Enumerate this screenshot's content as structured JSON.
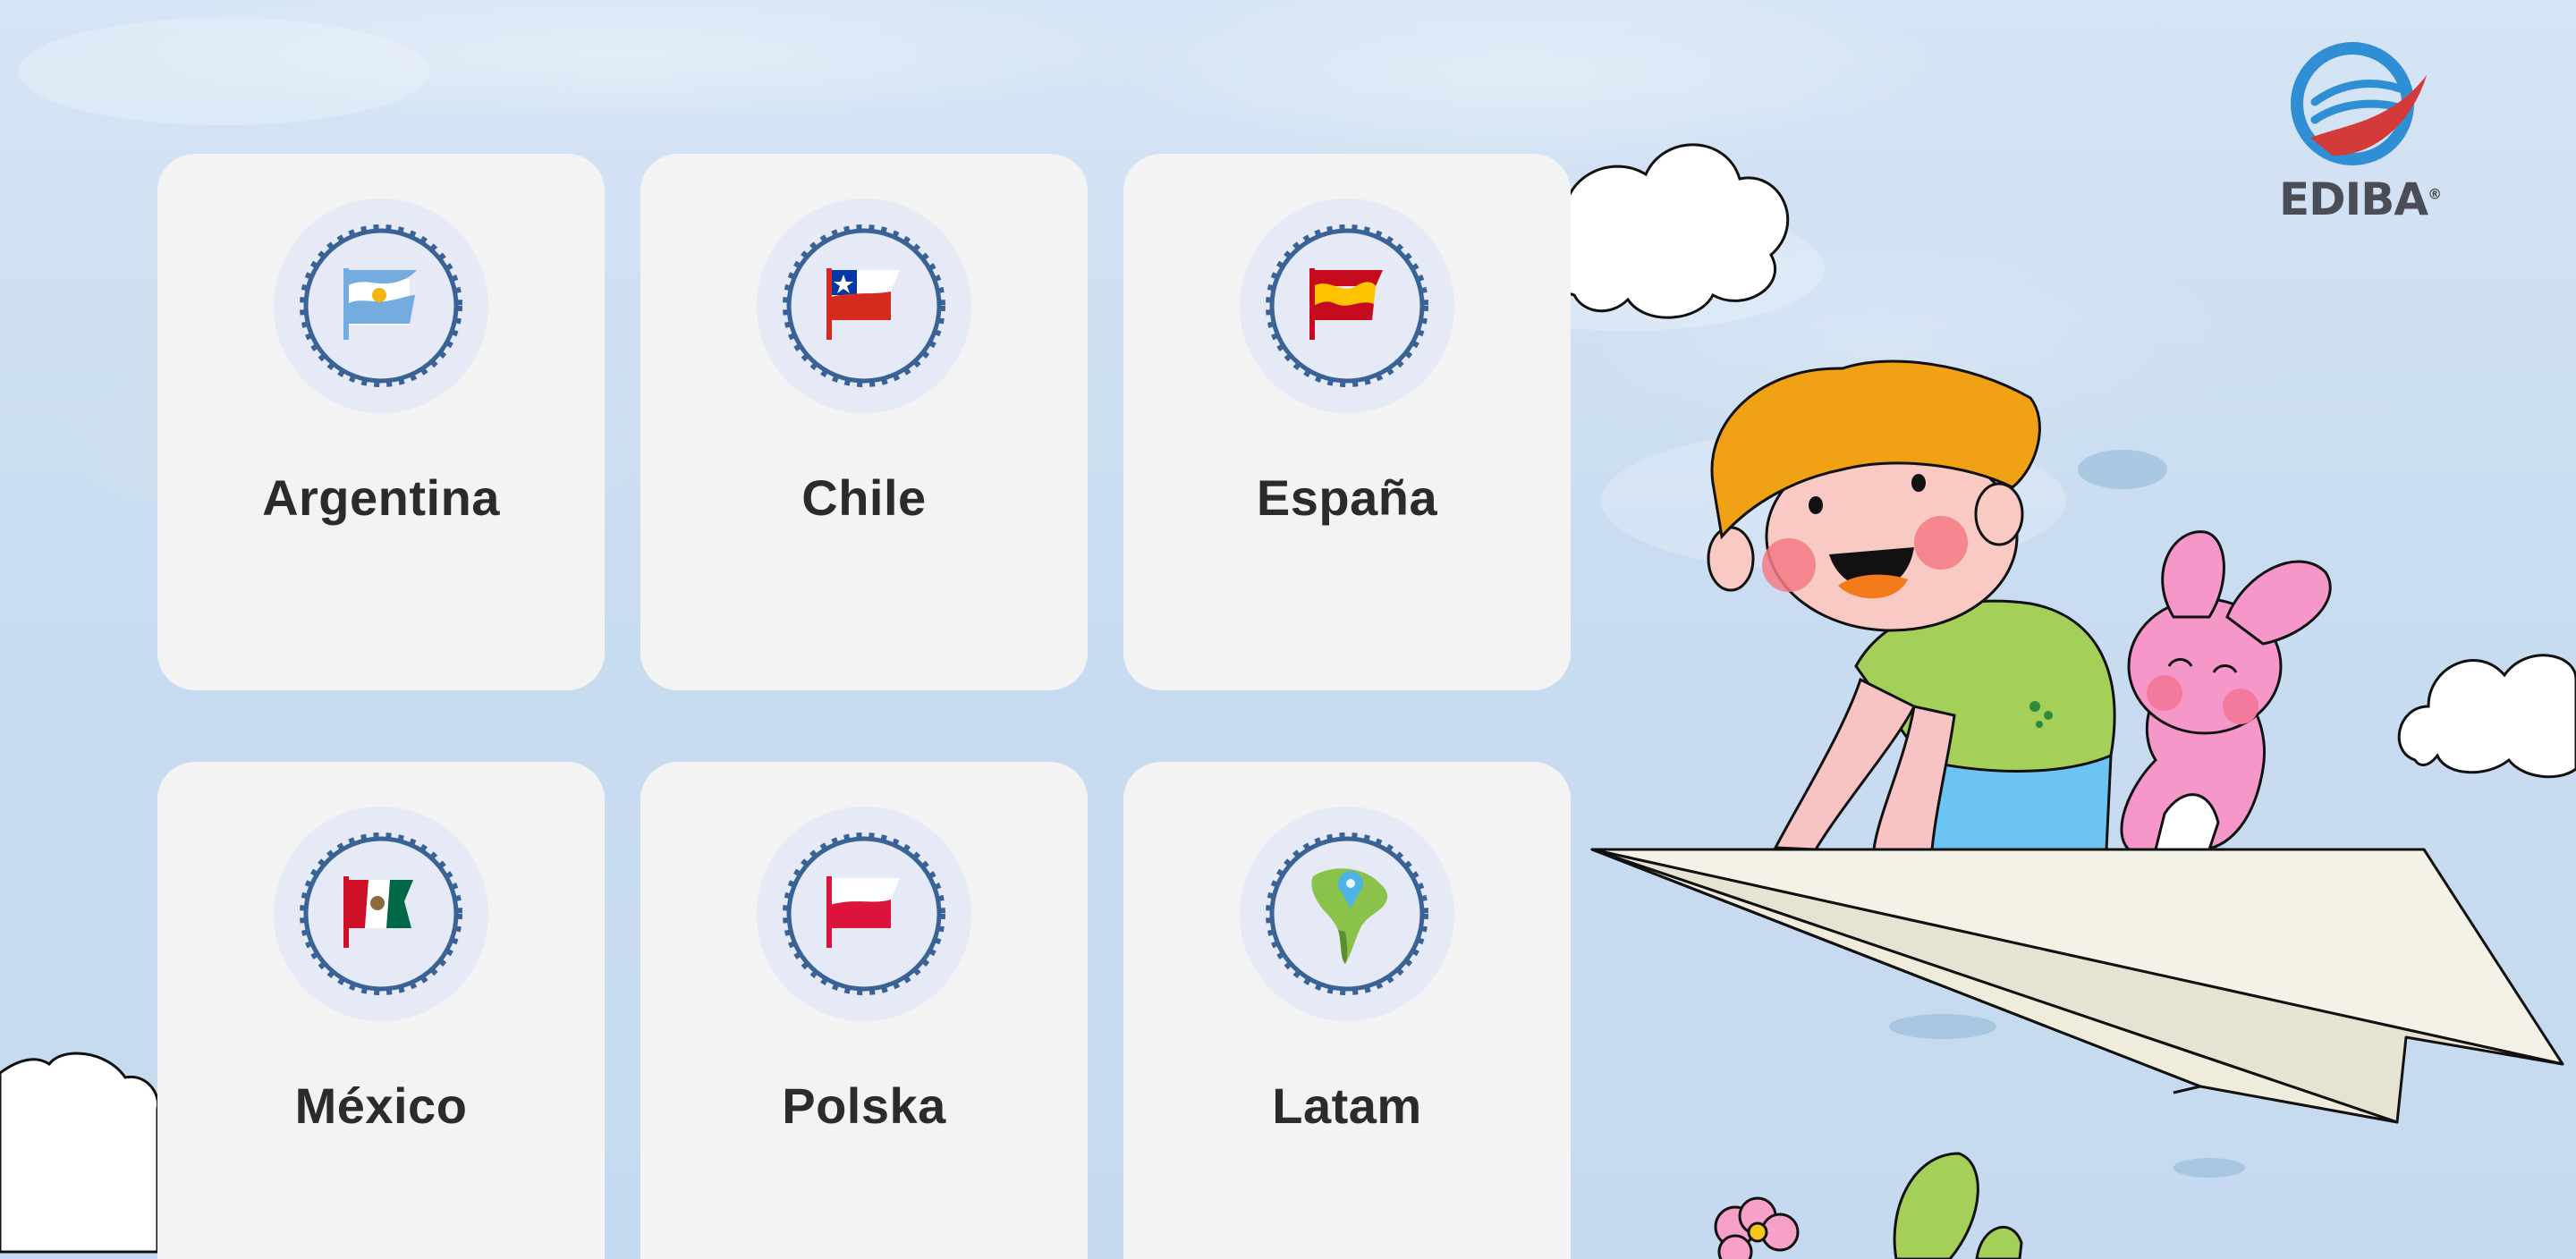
{
  "brand": {
    "name": "EDIBA",
    "mark": "®"
  },
  "cards": [
    {
      "label": "Argentina",
      "icon": "argentina-flag-icon"
    },
    {
      "label": "Chile",
      "icon": "chile-flag-icon"
    },
    {
      "label": "España",
      "icon": "spain-flag-icon"
    },
    {
      "label": "México",
      "icon": "mexico-flag-icon"
    },
    {
      "label": "Polska",
      "icon": "poland-flag-icon"
    },
    {
      "label": "Latam",
      "icon": "south-america-map-icon"
    }
  ],
  "colors": {
    "background": "#cddff2",
    "card": "#f3f3f4",
    "badge": "#e6e9f6",
    "badge_ring": "#3a6395",
    "label": "#2b2b2d",
    "logo_blue": "#2f8fd4",
    "logo_red": "#d33a3a",
    "logo_gray": "#4a4d55"
  }
}
